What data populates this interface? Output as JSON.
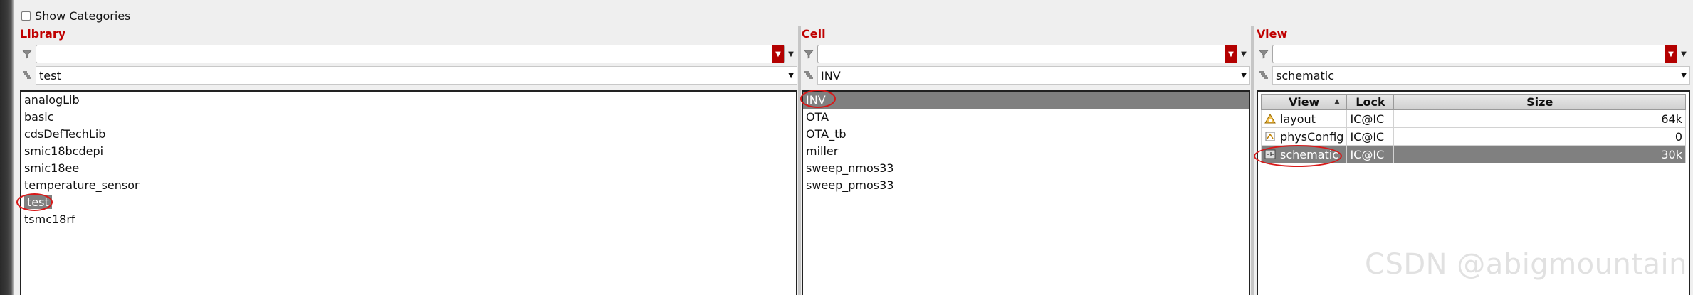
{
  "top": {
    "show_categories_label": "Show Categories"
  },
  "library": {
    "title": "Library",
    "filter_value": "",
    "name_value": "test",
    "items": [
      "analogLib",
      "basic",
      "cdsDefTechLib",
      "smic18bcdepi",
      "smic18ee",
      "temperature_sensor",
      "test",
      "tsmc18rf"
    ],
    "selected": "test"
  },
  "cell": {
    "title": "Cell",
    "filter_value": "",
    "name_value": "INV",
    "items": [
      "INV",
      "OTA",
      "OTA_tb",
      "miller",
      "sweep_nmos33",
      "sweep_pmos33"
    ],
    "selected": "INV"
  },
  "view": {
    "title": "View",
    "filter_value": "",
    "name_value": "schematic",
    "columns": [
      "View",
      "Lock",
      "Size"
    ],
    "rows": [
      {
        "view": "layout",
        "lock": "IC@IC",
        "size": "64k",
        "icon": "layout-view-icon"
      },
      {
        "view": "physConfig",
        "lock": "IC@IC",
        "size": "0",
        "icon": "config-view-icon"
      },
      {
        "view": "schematic",
        "lock": "IC@IC",
        "size": "30k",
        "icon": "schematic-view-icon"
      }
    ],
    "selected": "schematic"
  },
  "watermark": "CSDN @abigmountain",
  "colors": {
    "accent_red": "#c00000",
    "selection_gray": "#808080",
    "annotation_red": "#d81818"
  }
}
